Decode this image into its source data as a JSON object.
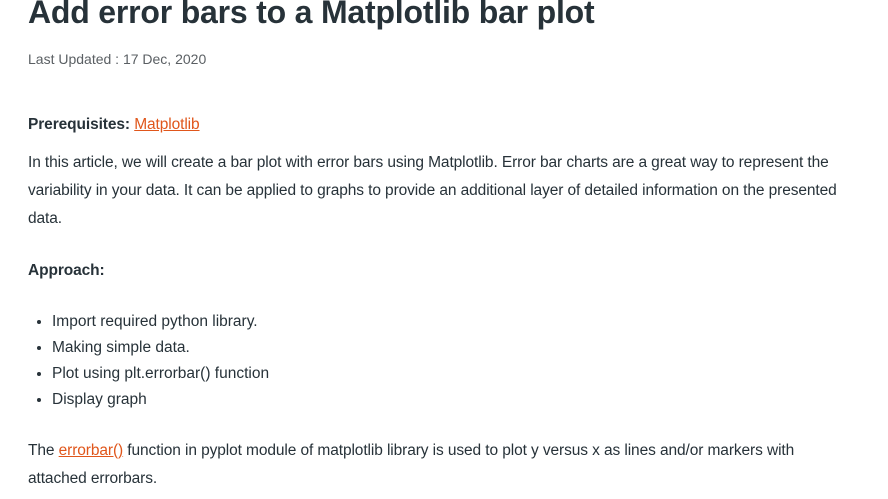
{
  "article": {
    "title": "Add error bars to a Matplotlib bar plot",
    "last_updated": "Last Updated : 17 Dec, 2020",
    "prerequisites_label": "Prerequisites:",
    "prerequisites_link": "Matplotlib",
    "intro": "In this article, we will create a bar plot with error bars using Matplotlib. Error bar charts are a great way to represent the variability in your data. It can be applied to graphs to provide an additional layer of detailed information on the presented data.",
    "approach_label": "Approach:",
    "steps": [
      "Import required python library.",
      "Making simple data.",
      "Plot using plt.errorbar() function",
      "Display graph"
    ],
    "errorbar_prefix": "The",
    "errorbar_link": "errorbar()",
    "errorbar_text": " function in pyplot module of matplotlib library is used to plot y versus x as lines and/or markers with attached errorbars."
  },
  "colors": {
    "text": "#273239",
    "link": "#e0561b"
  }
}
